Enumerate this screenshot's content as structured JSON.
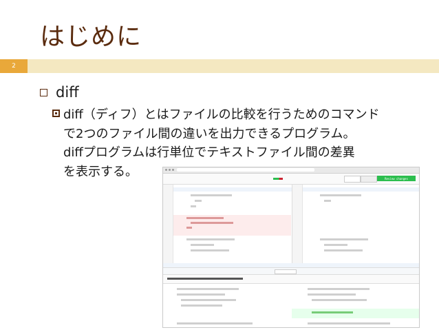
{
  "slide": {
    "title": "はじめに",
    "page_number": "2",
    "bullet_level1": "diff",
    "bullet_level2_lines": [
      "diff（ディフ）とはファイルの比較を行うためのコマンド",
      "で2つのファイル間の違いを出力できるプログラム。",
      "diffプログラムは行単位でテキストファイル間の差異",
      "を表示する。"
    ]
  },
  "screenshot": {
    "review_button": "Review changes"
  },
  "colors": {
    "title": "#5a2b0e",
    "rule_band": "#f4e8c1",
    "page_badge": "#e9a83a",
    "deleted_bg": "#fdecec",
    "added_bg": "#e6ffec",
    "review_button": "#2cbe4e"
  },
  "icons": {
    "bullet_level1": "hollow-square-icon",
    "bullet_level2": "filled-square-icon"
  }
}
